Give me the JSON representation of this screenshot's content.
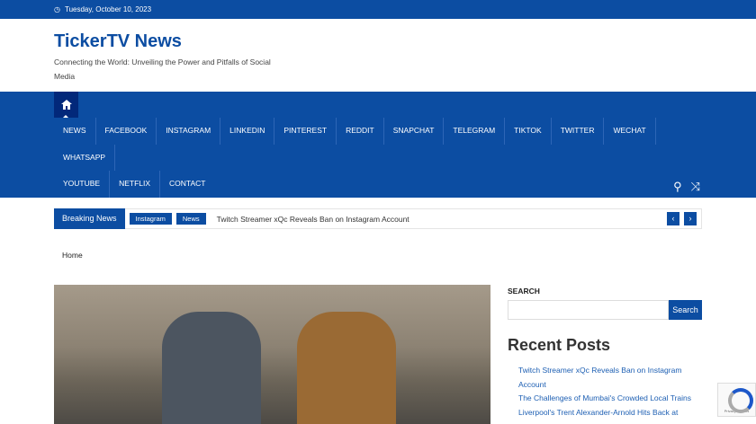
{
  "topbar": {
    "date": "Tuesday, October 10, 2023"
  },
  "site": {
    "title": "TickerTV News",
    "tagline": "Connecting the World: Unveiling the Power and Pitfalls of Social Media"
  },
  "nav": {
    "items": [
      "NEWS",
      "FACEBOOK",
      "INSTAGRAM",
      "LINKEDIN",
      "PINTEREST",
      "REDDIT",
      "SNAPCHAT",
      "TELEGRAM",
      "TIKTOK",
      "TWITTER",
      "WECHAT",
      "WHATSAPP",
      "YOUTUBE",
      "NETFLIX",
      "CONTACT"
    ]
  },
  "ticker": {
    "label": "Breaking News",
    "tags": [
      "Instagram",
      "News"
    ],
    "headline": "Twitch Streamer xQc Reveals Ban on Instagram Account",
    "prev": "‹",
    "next": "›"
  },
  "breadcrumb": "Home",
  "sidebar": {
    "search_label": "SEARCH",
    "search_button": "Search",
    "recent_title": "Recent Posts",
    "posts": [
      "Twitch Streamer xQc Reveals Ban on Instagram Account",
      "The Challenges of Mumbai's Crowded Local Trains",
      "Liverpool's Trent Alexander-Arnold Hits Back at"
    ]
  },
  "recaptcha": "Privacy - Terms"
}
